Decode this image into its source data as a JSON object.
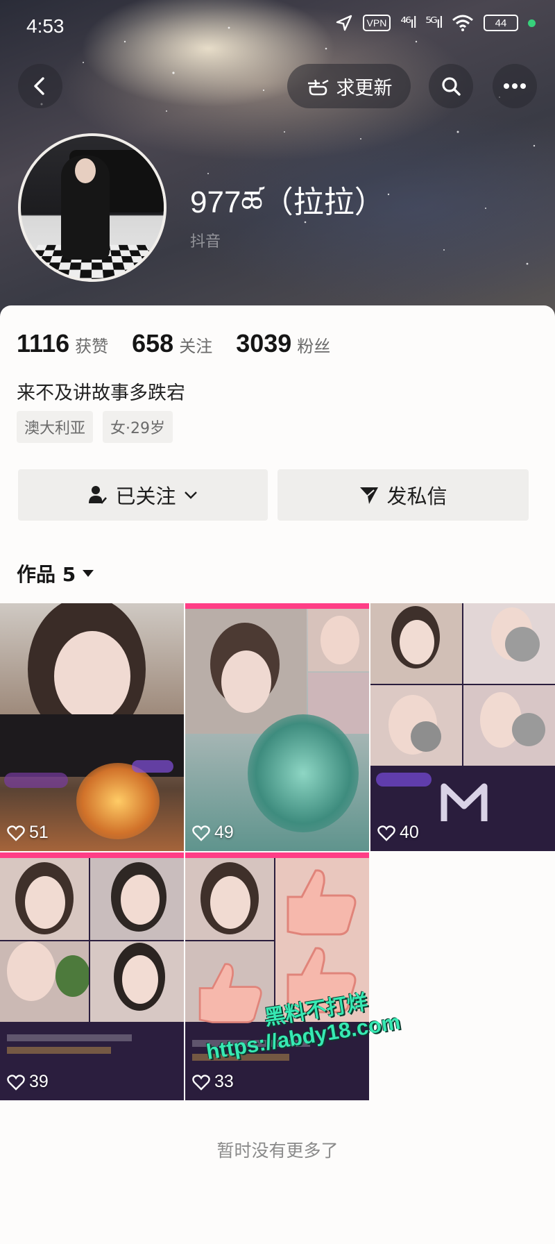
{
  "status_bar": {
    "time": "4:53",
    "vpn": "VPN",
    "signal1": "⁴⁶ıl",
    "signal2": "⁵ᴳıl",
    "wifi": "≋",
    "battery": "44"
  },
  "header": {
    "update_label": "求更新",
    "update_icon": "hand-pointer-icon",
    "back_icon": "chevron-left-icon",
    "search_icon": "search-icon",
    "more_icon": "more-dots-icon"
  },
  "profile": {
    "name": "977ཚ（拉拉）",
    "platform": "抖音",
    "stats": [
      {
        "value": "1116",
        "label": "获赞"
      },
      {
        "value": "658",
        "label": "关注"
      },
      {
        "value": "3039",
        "label": "粉丝"
      }
    ],
    "bio": "来不及讲故事多跌宕",
    "tags": [
      "澳大利亚",
      "女·29岁"
    ]
  },
  "actions": {
    "follow_label": "已关注",
    "message_label": "发私信"
  },
  "works": {
    "title": "作品 5",
    "items": [
      {
        "likes": "51"
      },
      {
        "likes": "49"
      },
      {
        "likes": "40"
      },
      {
        "likes": "39"
      },
      {
        "likes": "33"
      }
    ],
    "end_text": "暂时没有更多了"
  },
  "watermark": {
    "line1": "黑料不打烊",
    "line2": "https://abdy18.com"
  },
  "colors": {
    "accent_pink": "#ff3e86",
    "watermark_green": "#37e9b3",
    "status_green": "#37d17b"
  }
}
